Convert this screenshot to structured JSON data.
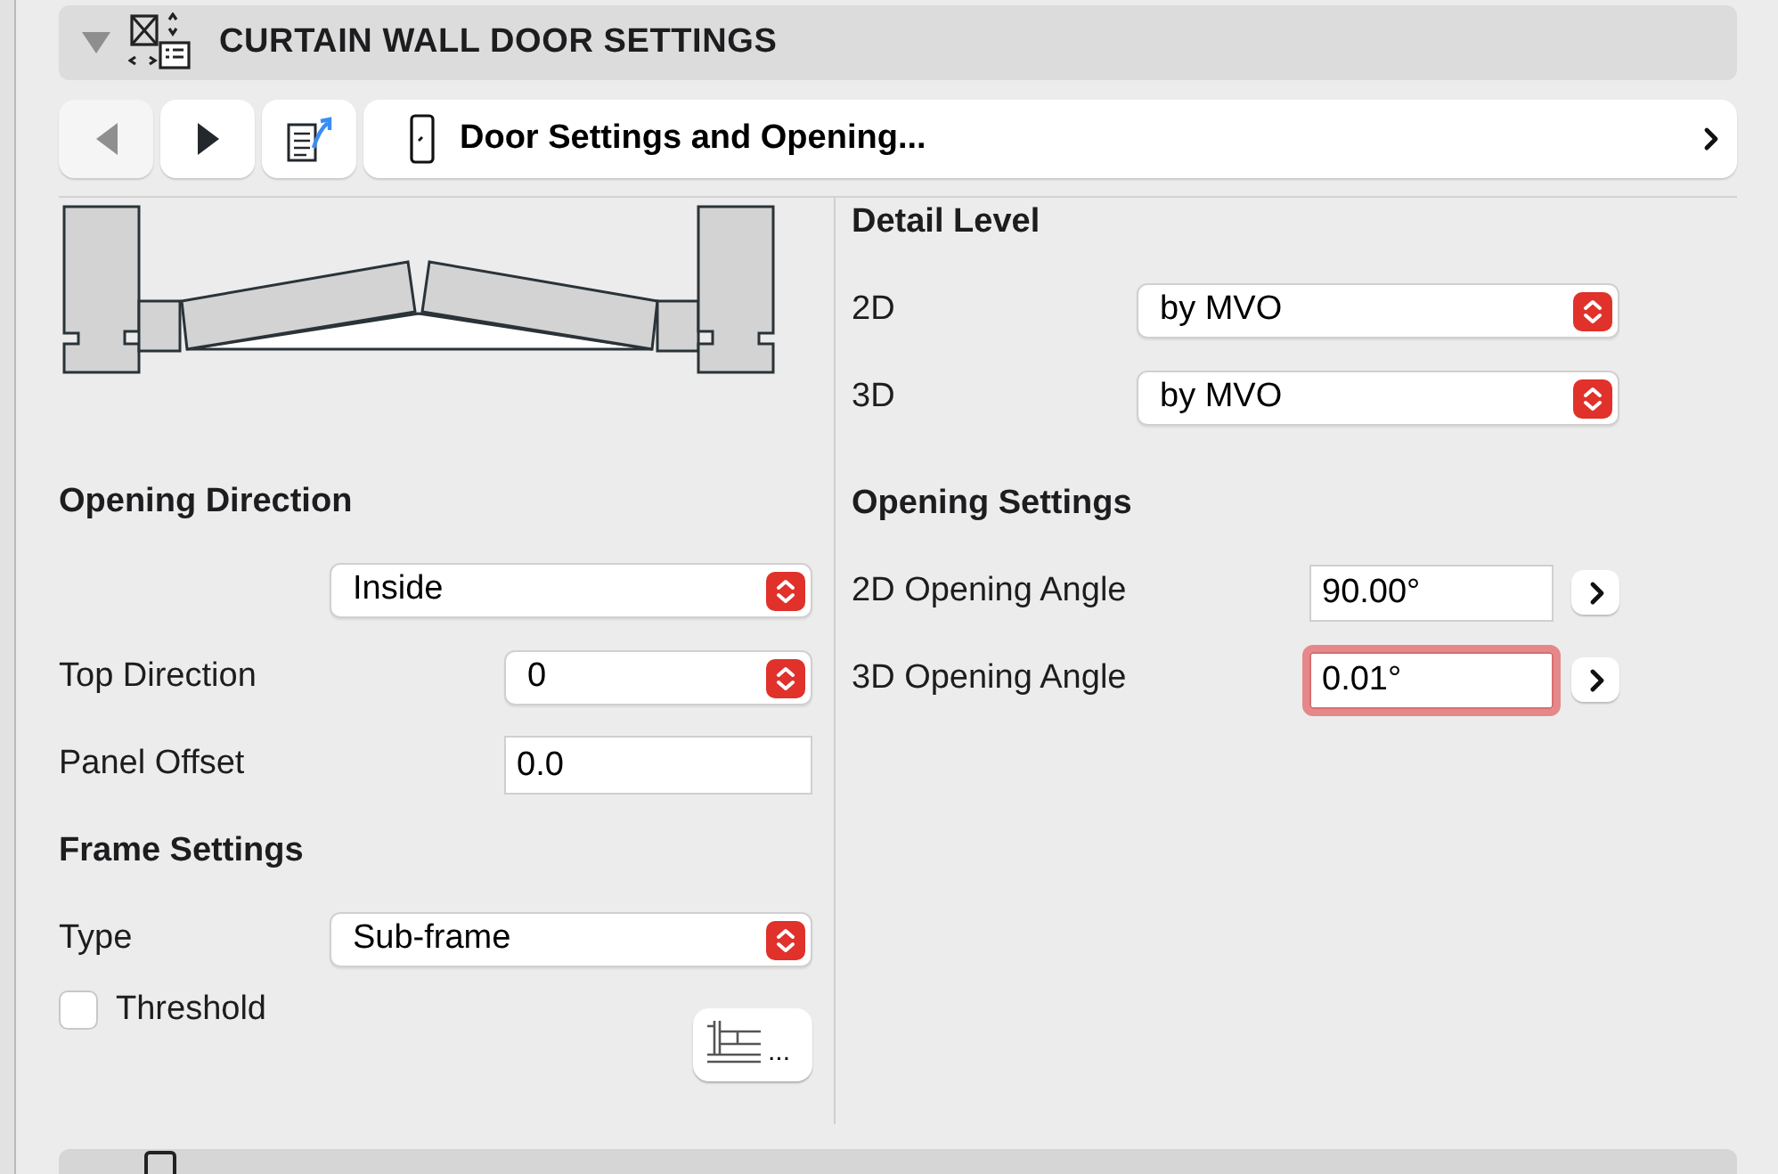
{
  "panel": {
    "title": "CURTAIN WALL DOOR SETTINGS",
    "expanded": true
  },
  "toolbar": {
    "buttons": [
      {
        "kind": "back",
        "disabled": true
      },
      {
        "kind": "forward",
        "disabled": false
      },
      {
        "kind": "export",
        "disabled": false
      }
    ],
    "page": {
      "label": "Door Settings and Opening..."
    }
  },
  "left_column": [
    {
      "kind": "heading",
      "label": "Opening Direction"
    },
    {
      "kind": "wide-select",
      "value": "Inside"
    },
    {
      "kind": "select",
      "label": "Top Direction",
      "value": "0"
    },
    {
      "kind": "input",
      "label": "Panel Offset",
      "value": "0.0"
    },
    {
      "kind": "heading",
      "label": "Frame Settings"
    },
    {
      "kind": "wide-select",
      "label": "Type",
      "value": "Sub-frame"
    },
    {
      "kind": "checkbox",
      "label": "Threshold",
      "checked": false,
      "button_text": "..."
    }
  ],
  "right_column": [
    {
      "kind": "heading",
      "label": "Detail Level"
    },
    {
      "kind": "wide-select",
      "label": "2D",
      "value": "by MVO"
    },
    {
      "kind": "wide-select",
      "label": "3D",
      "value": "by MVO"
    },
    {
      "kind": "heading",
      "label": "Opening Settings"
    },
    {
      "kind": "angle",
      "label": "2D Opening Angle",
      "value": "90.00°",
      "focused": false
    },
    {
      "kind": "angle",
      "label": "3D Opening Angle",
      "value": "0.01°",
      "focused": true
    }
  ]
}
